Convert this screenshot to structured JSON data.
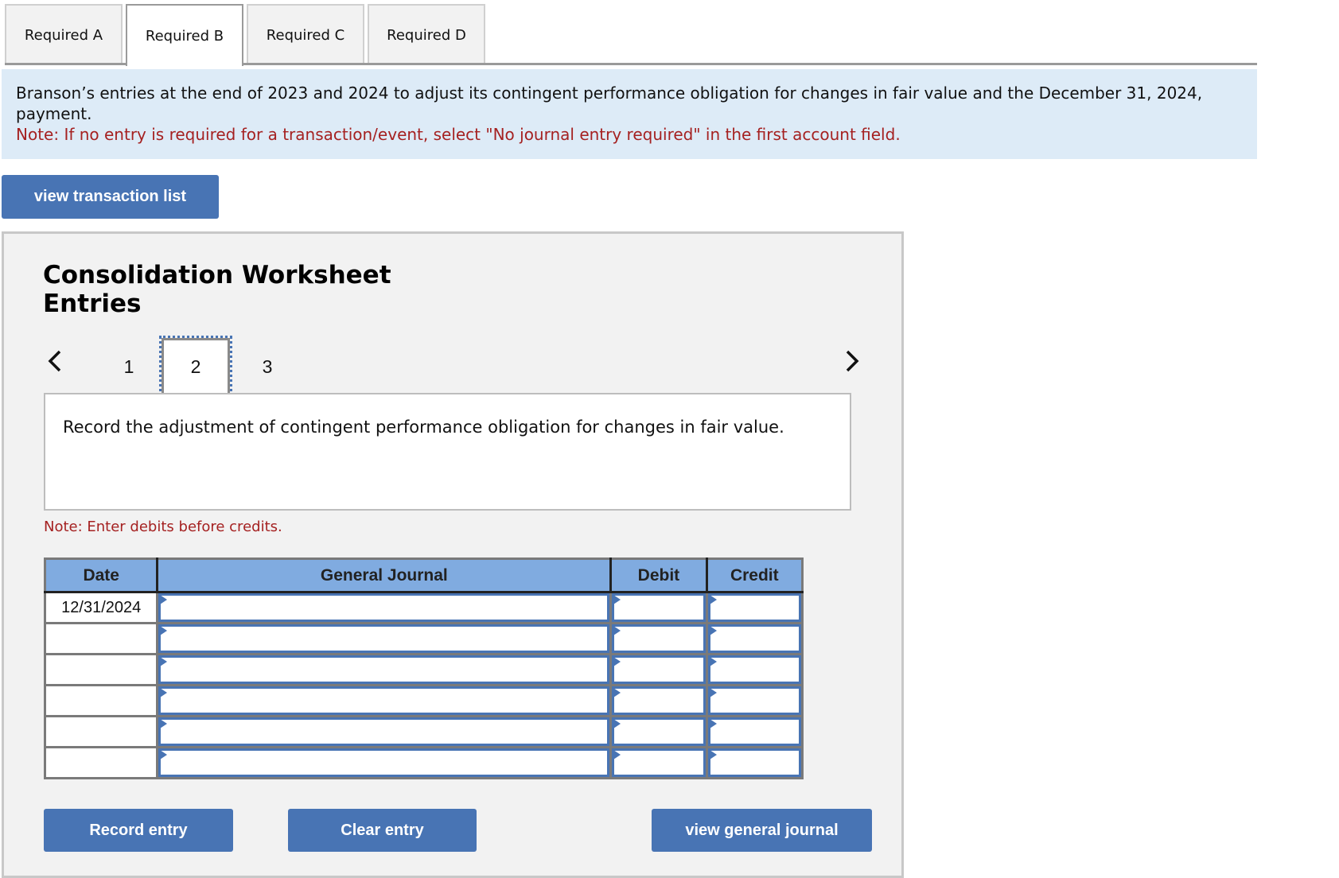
{
  "tabs": [
    {
      "label": "Required A",
      "active": false
    },
    {
      "label": "Required B",
      "active": true
    },
    {
      "label": "Required C",
      "active": false
    },
    {
      "label": "Required D",
      "active": false
    }
  ],
  "banner": {
    "text": "Branson’s entries at the end of 2023 and 2024 to adjust its contingent performance obligation for changes in fair value and the December 31, 2024, payment.",
    "note": "Note: If no entry is required for a transaction/event, select \"No journal entry required\" in the first account field."
  },
  "buttons": {
    "view_transaction_list": "view transaction list",
    "record_entry": "Record entry",
    "clear_entry": "Clear entry",
    "view_general_journal": "view general journal"
  },
  "worksheet": {
    "title": "Consolidation Worksheet Entries",
    "pager": {
      "prev_icon": "chevron-left-icon",
      "next_icon": "chevron-right-icon",
      "pages": [
        "1",
        "2",
        "3"
      ],
      "current_page": "2"
    },
    "prompt": "Record the adjustment of contingent performance obligation for changes in fair value.",
    "note": "Note: Enter debits before credits."
  },
  "journal": {
    "colors": {
      "header_bg": "#80abe0",
      "input_border": "#4874b4",
      "note_red": "#a52121"
    },
    "headers": {
      "date": "Date",
      "account": "General Journal",
      "debit": "Debit",
      "credit": "Credit"
    },
    "rows": [
      {
        "date": "12/31/2024",
        "account": "",
        "debit": "",
        "credit": ""
      },
      {
        "date": "",
        "account": "",
        "debit": "",
        "credit": ""
      },
      {
        "date": "",
        "account": "",
        "debit": "",
        "credit": ""
      },
      {
        "date": "",
        "account": "",
        "debit": "",
        "credit": ""
      },
      {
        "date": "",
        "account": "",
        "debit": "",
        "credit": ""
      },
      {
        "date": "",
        "account": "",
        "debit": "",
        "credit": ""
      }
    ]
  }
}
